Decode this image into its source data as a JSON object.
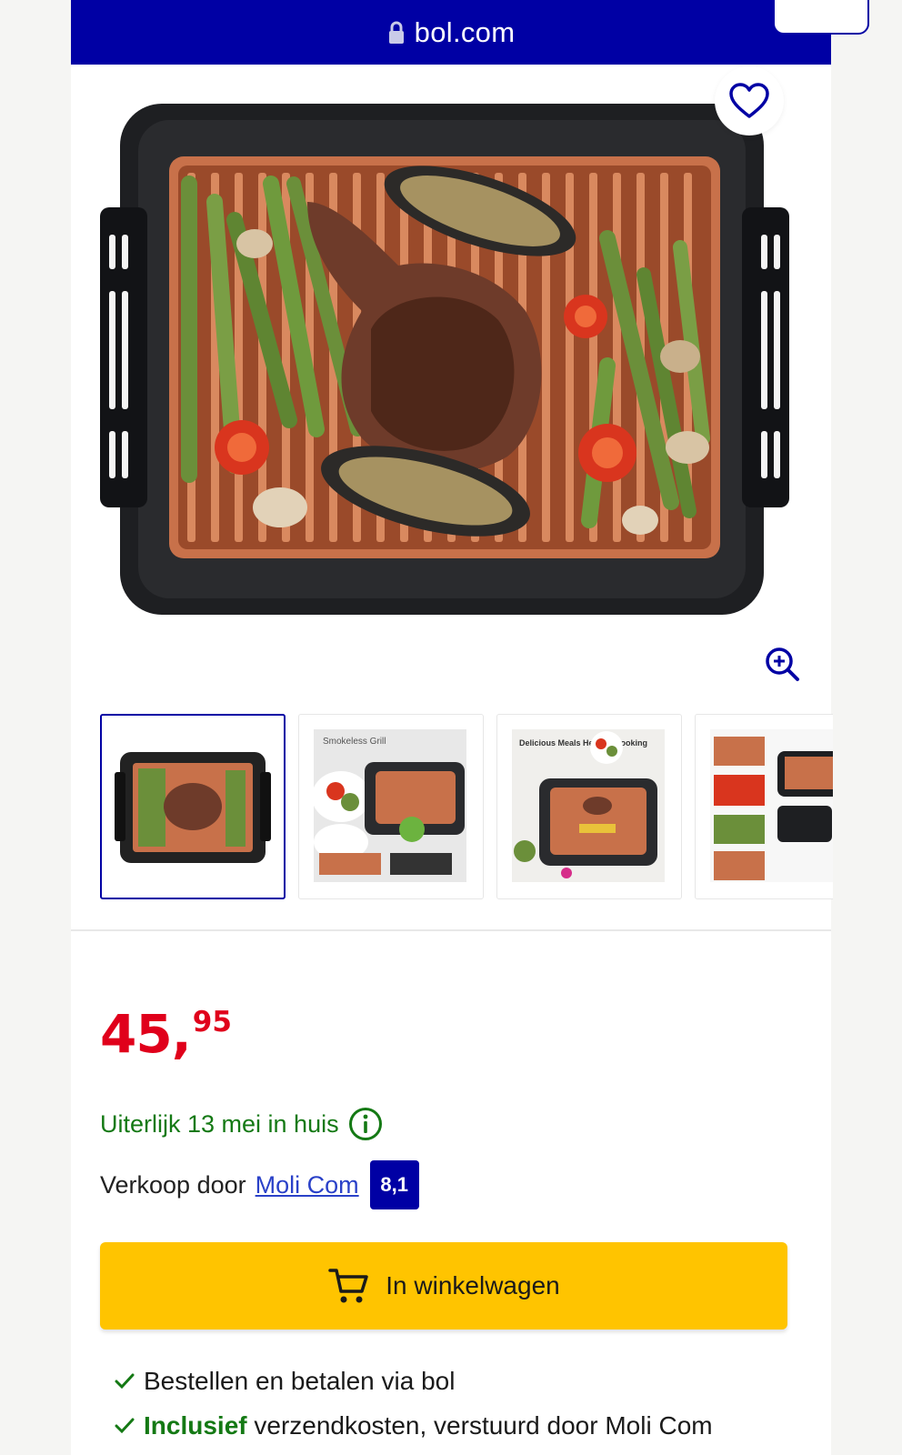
{
  "browser": {
    "url": "bol.com"
  },
  "product": {
    "price_main": "45,",
    "price_cents": "95",
    "delivery_text": "Uiterlijk 13 mei in huis",
    "seller_prefix": "Verkoop door",
    "seller_name": "Moli Com",
    "seller_rating": "8,1",
    "thumbnails": [
      {
        "caption": ""
      },
      {
        "caption": "Smokeless Grill"
      },
      {
        "caption": "Delicious Meals Healthy Cooking"
      },
      {
        "caption": ""
      }
    ]
  },
  "cart_button": {
    "label": "In winkelwagen"
  },
  "usps": [
    {
      "bold": "",
      "text": "Bestellen en betalen via bol"
    },
    {
      "bold": "Inclusief",
      "text": " verzendkosten, verstuurd door Moli Com"
    }
  ],
  "colors": {
    "brand_blue": "#0000a4",
    "price_red": "#e0001b",
    "delivery_green": "#147914",
    "cart_yellow": "#ffc400",
    "grill_copper": "#c8714a"
  },
  "icons": [
    "lock-icon",
    "heart-icon",
    "zoom-in-icon",
    "info-icon",
    "cart-icon",
    "check-icon"
  ]
}
